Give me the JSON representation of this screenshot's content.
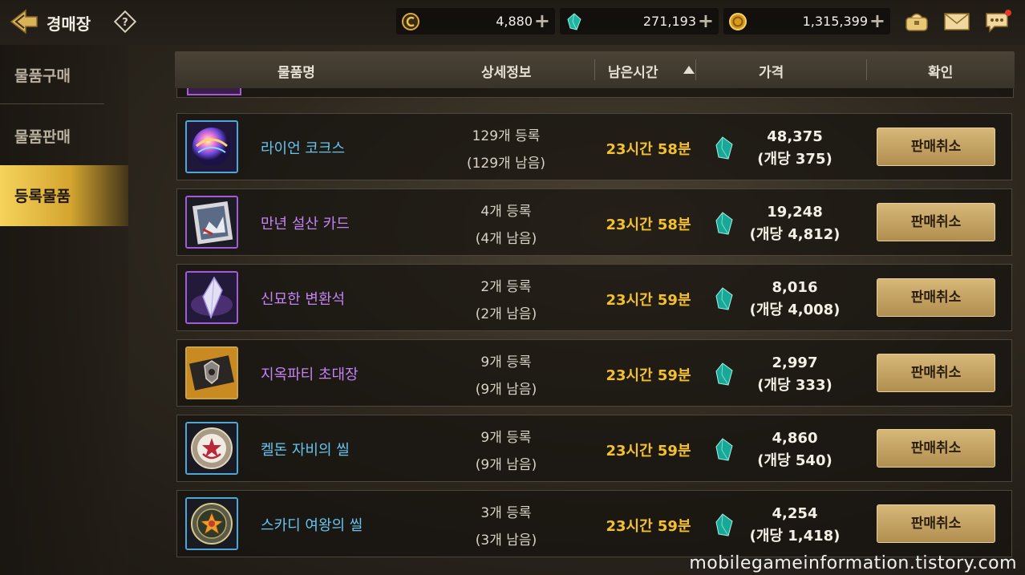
{
  "header": {
    "title": "경매장",
    "currencies": [
      {
        "icon": "crown-coin-icon",
        "value": "4,880"
      },
      {
        "icon": "teal-gem-icon",
        "value": "271,193"
      },
      {
        "icon": "gold-coin-icon",
        "value": "1,315,399"
      }
    ],
    "top_icons": [
      "purse-icon",
      "mail-icon",
      "chat-bubble-icon"
    ]
  },
  "sidebar": {
    "items": [
      {
        "label": "물품구매"
      },
      {
        "label": "물품판매"
      },
      {
        "label": "등록물품"
      }
    ],
    "active_index": 2
  },
  "table": {
    "columns": [
      "물품명",
      "상세정보",
      "남은시간",
      "가격",
      "확인"
    ],
    "sorted_column": "남은시간",
    "sort_direction": "ascending",
    "rows": [
      {
        "icon": "rainbow-orb-icon",
        "name": "라이언 코크스",
        "name_color": "#67c3ef",
        "detail_registered": "129개 등록",
        "detail_remaining": "(129개 남음)",
        "time_left": "23시간 58분",
        "price_total": "48,375",
        "price_each": "(개당 375)",
        "button": "판매취소"
      },
      {
        "icon": "snow-card-icon",
        "name": "만년 설산 카드",
        "name_color": "#c482f2",
        "detail_registered": "4개 등록",
        "detail_remaining": "(4개 남음)",
        "time_left": "23시간 58분",
        "price_total": "19,248",
        "price_each": "(개당 4,812)",
        "button": "판매취소"
      },
      {
        "icon": "crystal-icon",
        "name": "신묘한 변환석",
        "name_color": "#c482f2",
        "detail_registered": "2개 등록",
        "detail_remaining": "(2개 남음)",
        "time_left": "23시간 59분",
        "price_total": "8,016",
        "price_each": "(개당 4,008)",
        "button": "판매취소"
      },
      {
        "icon": "invitation-icon",
        "name": "지옥파티 초대장",
        "name_color": "#c482f2",
        "detail_registered": "9개 등록",
        "detail_remaining": "(9개 남음)",
        "time_left": "23시간 59분",
        "price_total": "2,997",
        "price_each": "(개당 333)",
        "button": "판매취소"
      },
      {
        "icon": "red-seal-icon",
        "name": "켈돈 자비의 씰",
        "name_color": "#67c3ef",
        "detail_registered": "9개 등록",
        "detail_remaining": "(9개 남음)",
        "time_left": "23시간 59분",
        "price_total": "4,860",
        "price_each": "(개당 540)",
        "button": "판매취소"
      },
      {
        "icon": "queen-seal-icon",
        "name": "스카디 여왕의 씰",
        "name_color": "#67c3ef",
        "detail_registered": "3개 등록",
        "detail_remaining": "(3개 남음)",
        "time_left": "23시간 59분",
        "price_total": "4,254",
        "price_each": "(개당 1,418)",
        "button": "판매취소"
      }
    ]
  },
  "colors": {
    "time": "#f5c12b",
    "button": "#c9a867",
    "active_tab": "#f5d35c"
  },
  "watermark": "mobilegameinformation.tistory.com"
}
